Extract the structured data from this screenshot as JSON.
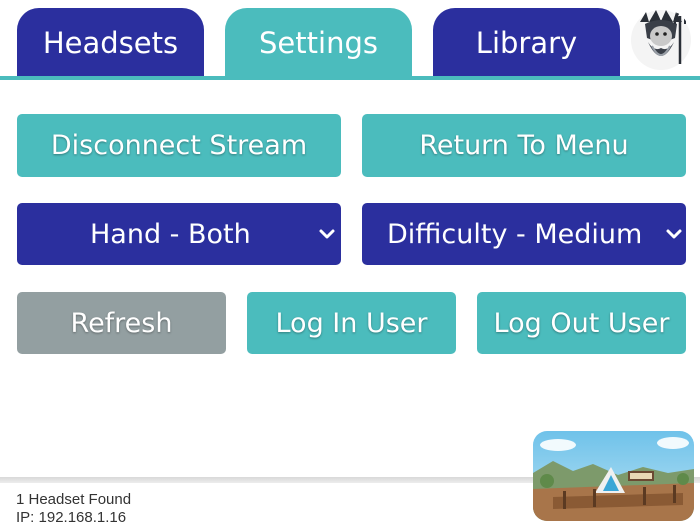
{
  "tabs": [
    {
      "label": "Headsets",
      "active": false
    },
    {
      "label": "Settings",
      "active": true
    },
    {
      "label": "Library",
      "active": false
    }
  ],
  "icons": {
    "logo": "trident-king-logo",
    "chevron": "chevron-down-icon",
    "preview": "vr-scene-thumbnail"
  },
  "settings": {
    "disconnect_label": "Disconnect Stream",
    "return_label": "Return To Menu",
    "hand_select": "Hand - Both",
    "difficulty_select": "Difficulty - Medium",
    "refresh_label": "Refresh",
    "login_label": "Log In User",
    "logout_label": "Log Out User"
  },
  "status": {
    "headsets_found": "1 Headset Found",
    "ip": "IP: 192.168.1.16"
  },
  "colors": {
    "navy": "#2b2f9e",
    "teal": "#4bbcbd",
    "grey": "#939fa1"
  }
}
